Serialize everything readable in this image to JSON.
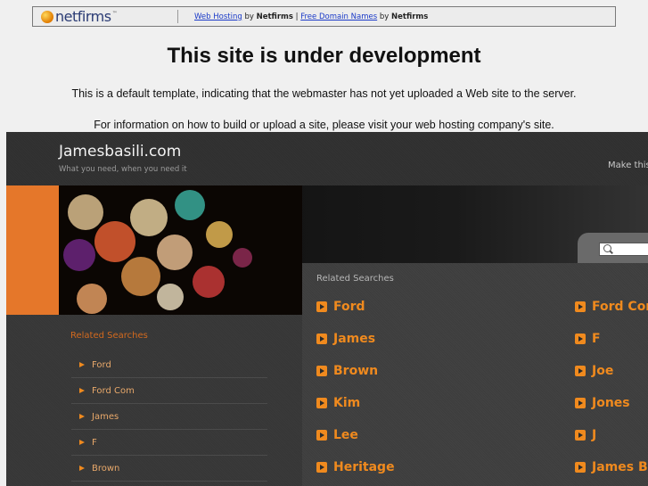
{
  "banner": {
    "logo": "netfirms",
    "link1": "Web Hosting",
    "by1": "by",
    "brand1": "Netfirms",
    "pipe": "|",
    "link2": "Free Domain Names",
    "by2": "by",
    "brand2": "Netfirms"
  },
  "notice": {
    "title": "This site is under development",
    "line1": "This is a default template, indicating that the webmaster has not yet uploaded a Web site to the server.",
    "line2": "For information on how to build or upload a site, please visit your web hosting company's site."
  },
  "park": {
    "site_name": "Jamesbasili.com",
    "tagline": "What you need, when you need it",
    "make_this": "Make this",
    "sidebar_title": "Related Searches",
    "sidebar_items": [
      "Ford",
      "Ford Com",
      "James",
      "F",
      "Brown"
    ],
    "main_title": "Related Searches",
    "results_left": [
      "Ford",
      "James",
      "Brown",
      "Kim",
      "Lee",
      "Heritage"
    ],
    "results_right": [
      "Ford Com",
      "F",
      "Joe",
      "Jones",
      "J",
      "James Br"
    ]
  },
  "colors": {
    "accent": "#f08a1e",
    "strip": "#e5772a",
    "link": "#1a3ac8"
  },
  "icons": [
    "globe-icon",
    "search-icon",
    "arrow-icon"
  ]
}
